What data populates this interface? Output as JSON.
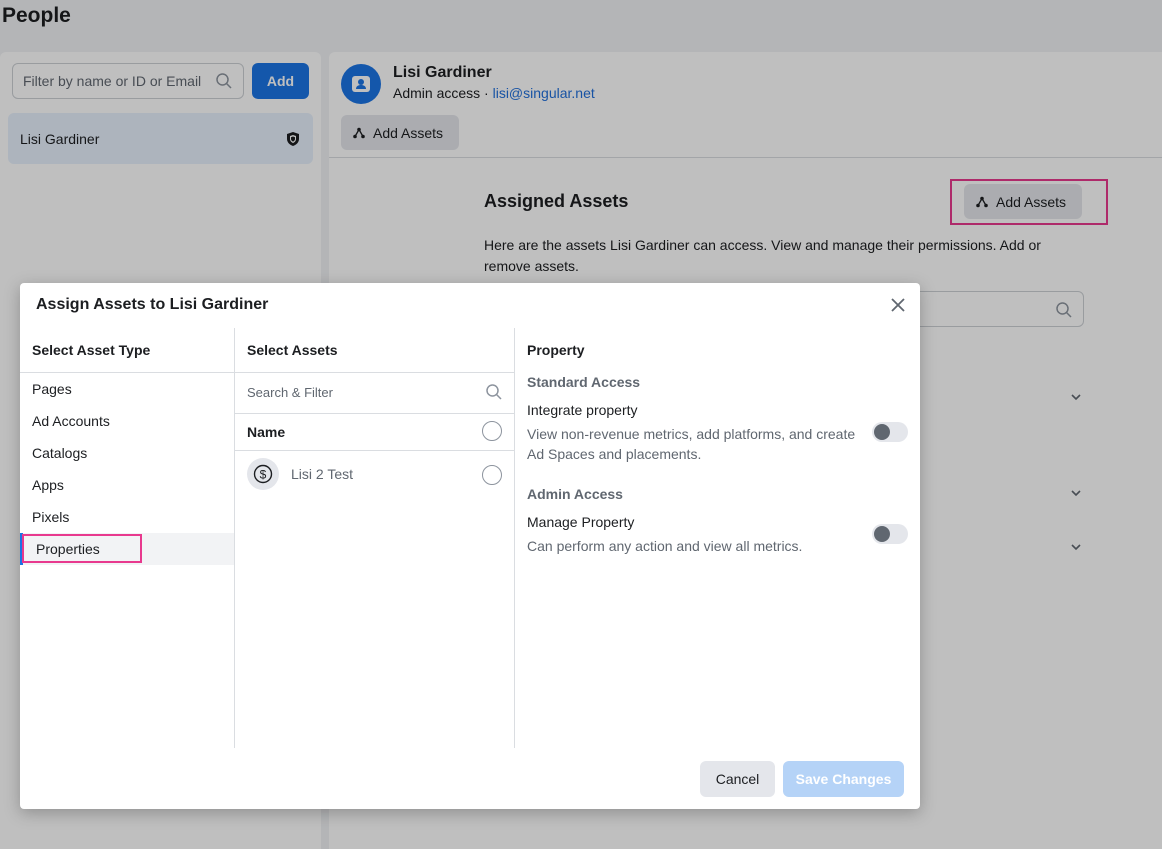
{
  "page": {
    "title": "People"
  },
  "left_panel": {
    "filter_placeholder": "Filter by name or ID or Email",
    "add_label": "Add",
    "people": [
      {
        "name": "Lisi Gardiner"
      }
    ]
  },
  "user": {
    "name": "Lisi Gardiner",
    "access": "Admin access · ",
    "email": "lisi@singular.net",
    "add_assets_label": "Add Assets"
  },
  "assigned": {
    "title": "Assigned Assets",
    "add_assets_label": "Add Assets",
    "description": "Here are the assets Lisi Gardiner can access. View and manage their permissions. Add or remove assets."
  },
  "modal": {
    "title": "Assign Assets to Lisi Gardiner",
    "asset_type_heading": "Select Asset Type",
    "asset_types": [
      "Pages",
      "Ad Accounts",
      "Catalogs",
      "Apps",
      "Pixels",
      "Properties"
    ],
    "selected_type": "Properties",
    "select_assets_heading": "Select Assets",
    "search_placeholder": "Search & Filter",
    "name_header": "Name",
    "assets": [
      {
        "name": "Lisi 2 Test",
        "icon": "dollar-icon"
      }
    ],
    "permissions": {
      "heading": "Property",
      "standard_heading": "Standard Access",
      "integrate_label": "Integrate property",
      "integrate_desc": "View non-revenue metrics, add platforms, and create Ad Spaces and placements.",
      "admin_heading": "Admin Access",
      "manage_label": "Manage Property",
      "manage_desc": "Can perform any action and view all metrics.",
      "integrate_on": false,
      "manage_on": false
    },
    "cancel_label": "Cancel",
    "save_label": "Save Changes"
  },
  "colors": {
    "accent": "#1b74e4",
    "highlight": "#e8398e",
    "save_disabled": "#b5d3f7"
  }
}
